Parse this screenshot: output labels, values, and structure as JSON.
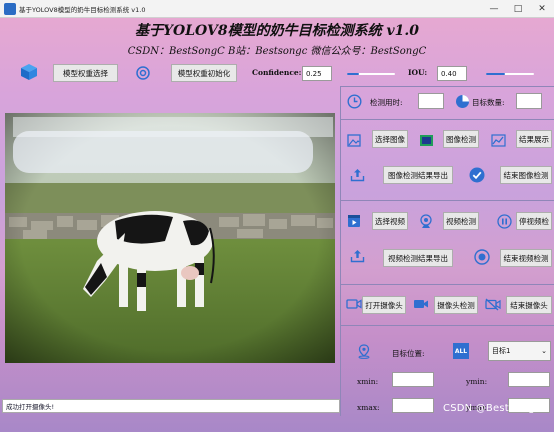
{
  "window": {
    "title": "基于YOLOV8模型的奶牛目标检测系统 v1.0",
    "controls": [
      "—",
      "□",
      "✕"
    ]
  },
  "header": {
    "title": "基于YOLOV8模型的奶牛目标检测系统 v1.0",
    "subtitle": "CSDN：BestSongC   B站：Bestsongc   微信公众号：BestSongC"
  },
  "toolbar": {
    "model_select_label": "模型权重选择",
    "model_init_label": "模型权重初始化",
    "confidence_label": "Confidence:",
    "confidence_value": "0.25",
    "iou_label": "IOU:",
    "iou_value": "0.40",
    "confidence_slider_fraction": 0.25,
    "iou_slider_fraction": 0.4
  },
  "stats": {
    "time_label": "检测用时:",
    "time_value": "",
    "count_label": "目标数量:",
    "count_value": ""
  },
  "image_panel": {
    "select_image": "选择图像",
    "detect_image": "图像检测",
    "show_result": "结果展示",
    "export_image": "图像检测结果导出",
    "end_image": "结束图像检测"
  },
  "video_panel": {
    "select_video": "选择视频",
    "detect_video": "视频检测",
    "pause_video": "停视频检",
    "export_video": "视频检测结果导出",
    "end_video": "结束视频检测"
  },
  "camera_panel": {
    "open_camera": "打开摄像头",
    "detect_camera": "摄像头检测",
    "close_camera": "结束摄像头"
  },
  "target_panel": {
    "position_label": "目标位置:",
    "all_badge": "ALL",
    "target_select_value": "目标1",
    "xmin_label": "xmin:",
    "ymin_label": "ymin:",
    "xmax_label": "xmax:",
    "ymax_label": "ymax:",
    "xmin_value": "",
    "ymin_value": "",
    "xmax_value": "",
    "ymax_value": ""
  },
  "status": {
    "message": "成功打开摄像头!"
  },
  "watermark": "CSDN @BestSongC",
  "colors": {
    "accent_blue": "#2f6fd0",
    "button_bg": "#e8e8e8"
  }
}
